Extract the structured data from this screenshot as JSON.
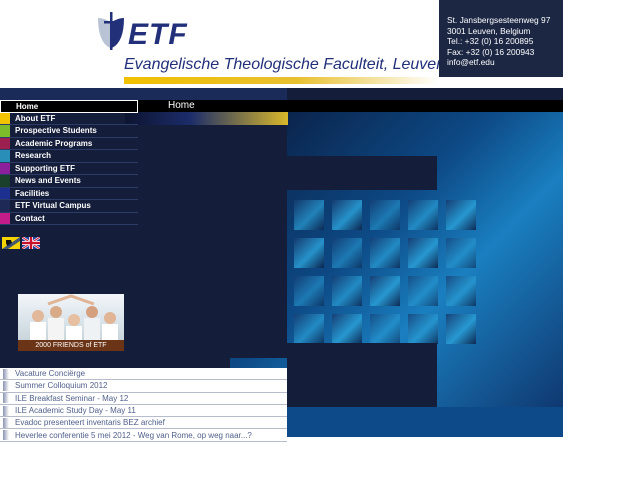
{
  "header": {
    "logo_text": "ETF",
    "faculty_name": "Evangelische Theologische Faculteit, Leuven"
  },
  "contact": {
    "street": "St. Jansbergsesteenweg 97",
    "city": "3001 Leuven, Belgium",
    "tel": "Tel.: +32 (0) 16 200895",
    "fax": "Fax: +32 (0) 16 200943",
    "email": "info@etf.edu"
  },
  "page_header": {
    "title": "Home"
  },
  "nav": {
    "items": [
      {
        "label": "Home",
        "color": "#000000"
      },
      {
        "label": "About ETF",
        "color": "#f2c400"
      },
      {
        "label": "Prospective Students",
        "color": "#7dbb2a"
      },
      {
        "label": "Academic Programs",
        "color": "#9b1f4f"
      },
      {
        "label": "Research",
        "color": "#2a8fb8"
      },
      {
        "label": "Supporting ETF",
        "color": "#8c1f9a"
      },
      {
        "label": "News and Events",
        "color": "#1a3f2a"
      },
      {
        "label": "Facilities",
        "color": "#1d2f8f"
      },
      {
        "label": "ETF Virtual Campus",
        "color": "#1e2a55"
      },
      {
        "label": "Contact",
        "color": "#c41d8a"
      }
    ]
  },
  "flags": [
    "Dutch (Flanders)",
    "English"
  ],
  "friends_banner": {
    "caption": "2000 FRIENDS of ETF"
  },
  "news": {
    "items": [
      "Vacature Conciërge",
      "Summer Colloquium 2012",
      "ILE Breakfast Seminar - May 12",
      "ILE Academic Study Day - May 11",
      "Evadoc presenteert inventaris BEZ archief",
      "Heverlee conferentie 5 mei 2012 - Weg van Rome, op weg naar...?"
    ]
  },
  "colors": {
    "dark_bg": "#141d3a",
    "brand_blue": "#22307a",
    "gold": "#f0c000"
  }
}
